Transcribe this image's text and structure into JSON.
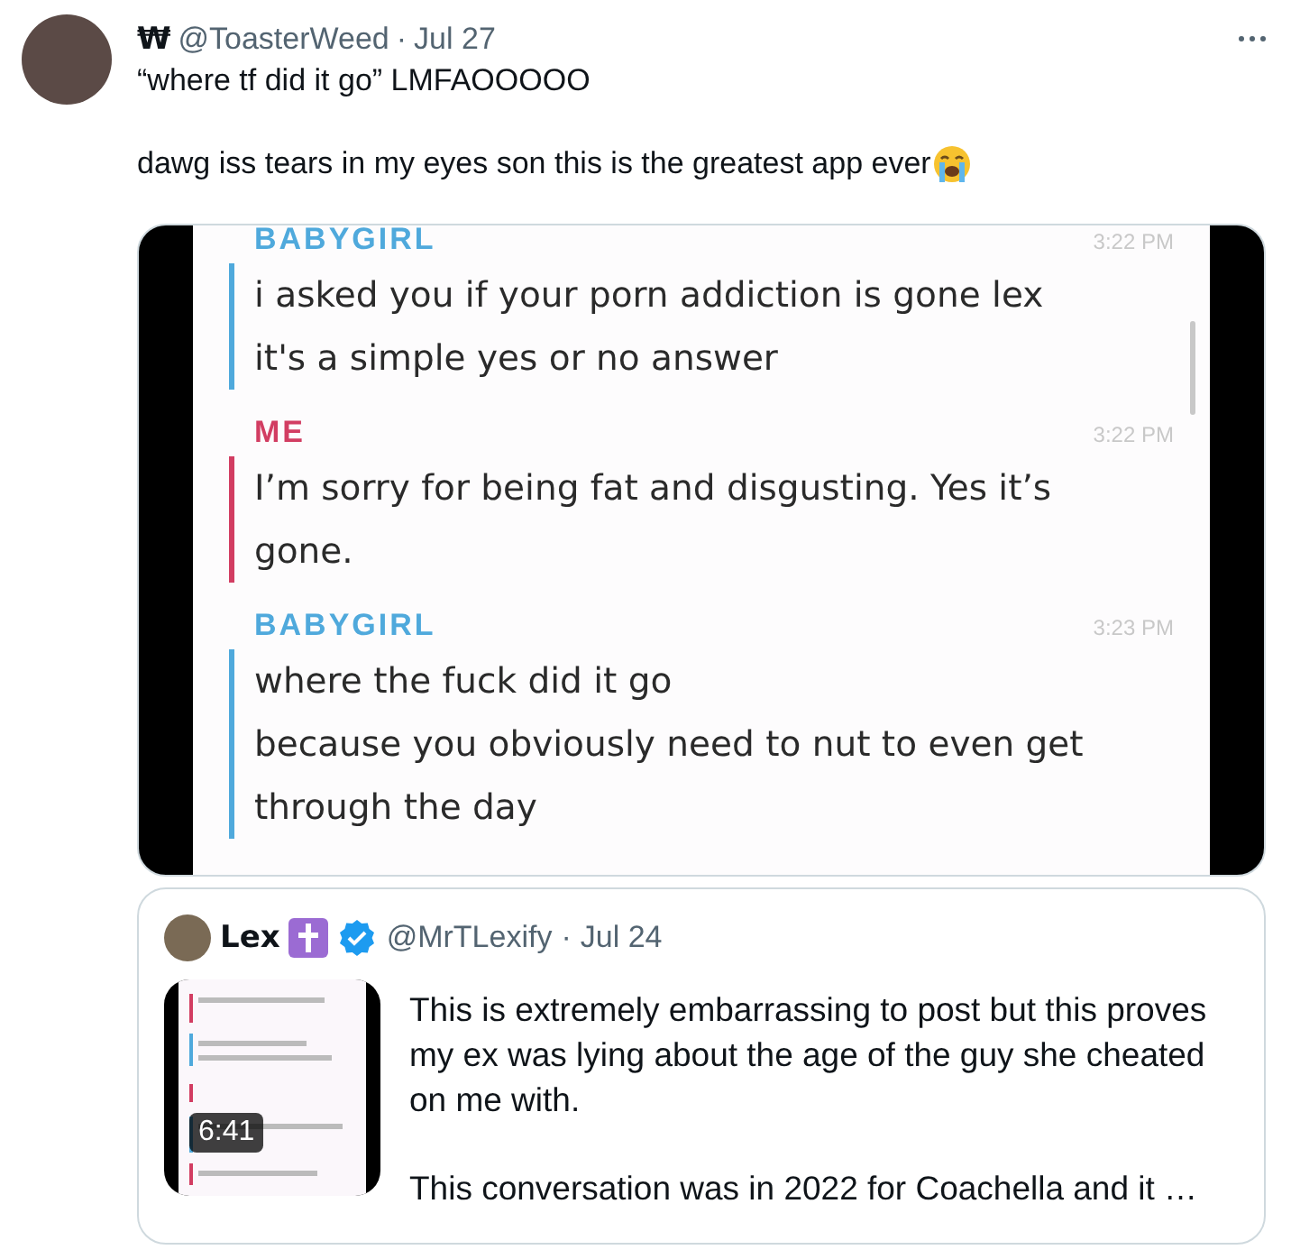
{
  "tweet": {
    "display_name": "₩",
    "handle": "@ToasterWeed",
    "separator": "·",
    "date": "Jul 27",
    "paragraphs": [
      "“where tf did it go” LMFAOOOOO",
      "dawg iss tears in my eyes son this is the greatest app ever"
    ]
  },
  "media": {
    "messages": [
      {
        "sender": "BABYGIRL",
        "color": "#4fa9dc",
        "time": "3:22 PM",
        "lines": [
          "i asked you if your porn addiction is gone lex",
          "it's a simple yes or no answer"
        ]
      },
      {
        "sender": "ME",
        "color": "#d23d62",
        "time": "3:22 PM",
        "lines": [
          "I’m sorry for being fat and disgusting. Yes it’s gone."
        ]
      },
      {
        "sender": "BABYGIRL",
        "color": "#4fa9dc",
        "time": "3:23 PM",
        "lines": [
          "where the fuck did it go",
          "because you obviously need to nut to even get through the day"
        ]
      }
    ]
  },
  "quote": {
    "display_name": "Lex",
    "handle": "@MrTLexify",
    "separator": "·",
    "date": "Jul 24",
    "verified": true,
    "paragraphs": [
      "This is extremely embarrassing to post but this proves my ex was lying about the age of the guy she cheated on me with.",
      "This conversation was in 2022 for Coachella and it …"
    ],
    "video": {
      "kind": "picture",
      "duration": "6:41"
    }
  }
}
